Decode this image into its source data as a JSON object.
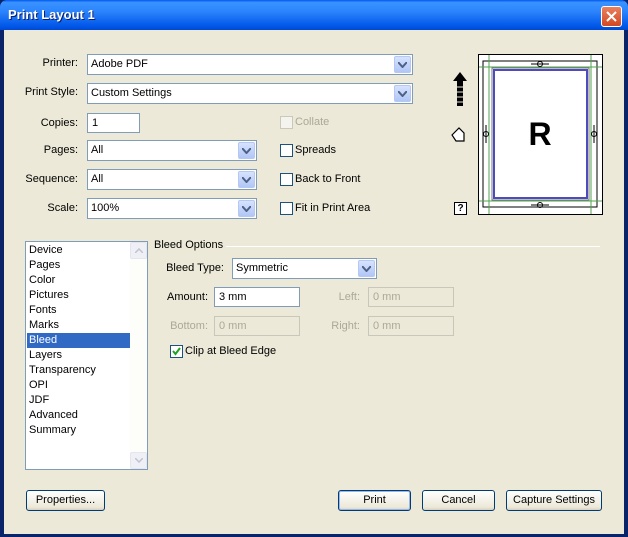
{
  "window": {
    "title": "Print Layout 1"
  },
  "printer": {
    "label": "Printer:",
    "value": "Adobe PDF"
  },
  "print_style": {
    "label": "Print Style:",
    "value": "Custom Settings"
  },
  "copies": {
    "label": "Copies:",
    "value": "1"
  },
  "pages": {
    "label": "Pages:",
    "value": "All"
  },
  "sequence": {
    "label": "Sequence:",
    "value": "All"
  },
  "scale": {
    "label": "Scale:",
    "value": "100%"
  },
  "options": {
    "collate": {
      "label": "Collate",
      "checked": false,
      "enabled": false
    },
    "spreads": {
      "label": "Spreads",
      "checked": false
    },
    "back_to_front": {
      "label": "Back to Front",
      "checked": false
    },
    "fit_in_print_area": {
      "label": "Fit in Print Area",
      "checked": false
    }
  },
  "preview": {
    "letter": "R",
    "help": "?"
  },
  "sidebar": {
    "items": [
      "Device",
      "Pages",
      "Color",
      "Pictures",
      "Fonts",
      "Marks",
      "Bleed",
      "Layers",
      "Transparency",
      "OPI",
      "JDF",
      "Advanced",
      "Summary"
    ],
    "selected": "Bleed"
  },
  "bleed": {
    "group_title": "Bleed Options",
    "type": {
      "label": "Bleed Type:",
      "value": "Symmetric"
    },
    "amount": {
      "label": "Amount:",
      "value": "3 mm"
    },
    "left": {
      "label": "Left:",
      "value": "0 mm"
    },
    "bottom": {
      "label": "Bottom:",
      "value": "0 mm"
    },
    "right": {
      "label": "Right:",
      "value": "0 mm"
    },
    "clip": {
      "label": "Clip at Bleed Edge",
      "checked": true
    }
  },
  "buttons": {
    "properties": "Properties...",
    "print": "Print",
    "cancel": "Cancel",
    "capture": "Capture Settings"
  },
  "colors": {
    "title_bar": "#0058ee",
    "selection": "#316ac5",
    "dialog_bg": "#ece9d8"
  }
}
